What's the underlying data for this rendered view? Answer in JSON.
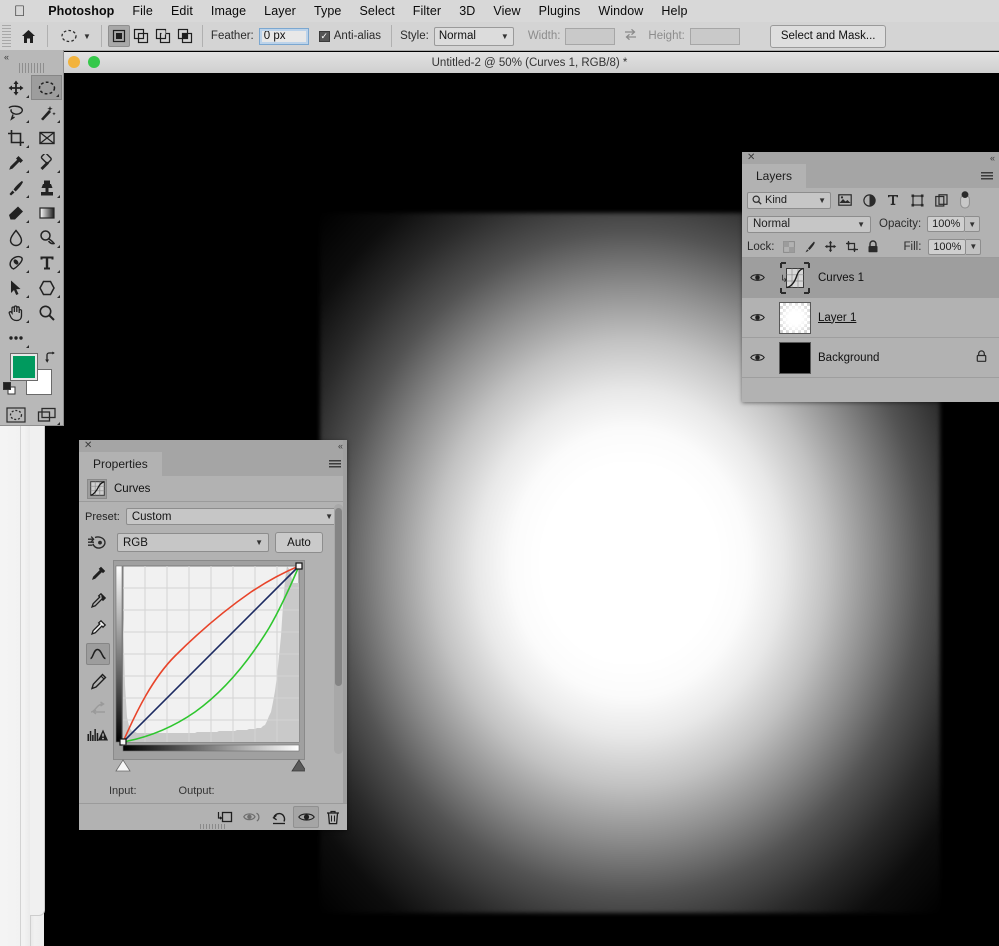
{
  "menubar": {
    "apple_icon": "apple-logo",
    "items": [
      "Photoshop",
      "File",
      "Edit",
      "Image",
      "Layer",
      "Type",
      "Select",
      "Filter",
      "3D",
      "View",
      "Plugins",
      "Window",
      "Help"
    ]
  },
  "options_bar": {
    "home_icon": "home-icon",
    "tool_preview_icon": "elliptical-marquee-icon",
    "selection_modes": [
      "new-selection",
      "add-to-selection",
      "subtract-from-selection",
      "intersect-with-selection"
    ],
    "active_selection_mode": 0,
    "feather_label": "Feather:",
    "feather_value": "0 px",
    "antialias_label": "Anti-alias",
    "antialias_checked": true,
    "style_label": "Style:",
    "style_value": "Normal",
    "width_label": "Width:",
    "width_value": "",
    "swap_icon": "swap-dimensions-icon",
    "height_label": "Height:",
    "height_value": "",
    "select_and_mask_label": "Select and Mask..."
  },
  "toolbar": {
    "collapse_icon": "collapse-double-chevron-icon",
    "tools": [
      {
        "name": "move-tool",
        "has_flyout": true,
        "active": false
      },
      {
        "name": "elliptical-marquee-tool",
        "has_flyout": true,
        "active": true
      },
      {
        "name": "lasso-tool",
        "has_flyout": true,
        "active": false
      },
      {
        "name": "magic-wand-tool",
        "has_flyout": true,
        "active": false
      },
      {
        "name": "crop-tool",
        "has_flyout": true,
        "active": false
      },
      {
        "name": "frame-tool",
        "has_flyout": false,
        "active": false
      },
      {
        "name": "eyedropper-tool",
        "has_flyout": true,
        "active": false
      },
      {
        "name": "spot-healing-brush-tool",
        "has_flyout": true,
        "active": false
      },
      {
        "name": "brush-tool",
        "has_flyout": true,
        "active": false
      },
      {
        "name": "clone-stamp-tool",
        "has_flyout": true,
        "active": false
      },
      {
        "name": "eraser-tool",
        "has_flyout": true,
        "active": false
      },
      {
        "name": "gradient-tool",
        "has_flyout": true,
        "active": false
      },
      {
        "name": "blur-tool",
        "has_flyout": true,
        "active": false
      },
      {
        "name": "dodge-tool",
        "has_flyout": true,
        "active": false
      },
      {
        "name": "pen-tool",
        "has_flyout": true,
        "active": false
      },
      {
        "name": "type-tool",
        "has_flyout": true,
        "active": false
      },
      {
        "name": "path-selection-tool",
        "has_flyout": true,
        "active": false
      },
      {
        "name": "shape-tool",
        "has_flyout": true,
        "active": false
      },
      {
        "name": "hand-tool",
        "has_flyout": true,
        "active": false
      },
      {
        "name": "zoom-tool",
        "has_flyout": false,
        "active": false
      },
      {
        "name": "edit-toolbar-tool",
        "has_flyout": true,
        "active": false
      }
    ],
    "foreground_color": "#009A5E",
    "background_color": "#FFFFFF",
    "swap_colors_icon": "swap-colors-icon",
    "default_colors_icon": "default-colors-icon",
    "quick_mask_icon": "quick-mask-icon",
    "screen_mode_icon": "screen-mode-icon"
  },
  "document": {
    "title": "Untitled-2 @ 50% (Curves 1, RGB/8) *",
    "traffic_lights": [
      "#f2b33d",
      "#35c84a"
    ],
    "zoom": "50%",
    "color_mode": "RGB/8",
    "active_layer": "Curves 1",
    "modified": true
  },
  "layers_panel": {
    "close_icon": "close-icon",
    "collapse_icon": "collapse-double-chevron-icon",
    "tab_label": "Layers",
    "menu_icon": "panel-menu-icon",
    "filter": {
      "search_icon": "search-icon",
      "kind_label": "Kind",
      "chevron_icon": "chevron-down-icon",
      "type_filters": [
        "pixel-layer-filter-icon",
        "adjustment-layer-filter-icon",
        "type-layer-filter-icon",
        "shape-layer-filter-icon",
        "smart-object-filter-icon"
      ],
      "toggle_icon": "filter-toggle-switch"
    },
    "blend_mode": "Normal",
    "opacity_label": "Opacity:",
    "opacity_value": "100%",
    "lock_label": "Lock:",
    "lock_icons": [
      "lock-transparent-pixels-icon",
      "lock-image-pixels-icon",
      "lock-position-icon",
      "lock-artboard-nesting-icon",
      "lock-all-icon"
    ],
    "fill_label": "Fill:",
    "fill_value": "100%",
    "layers": [
      {
        "name": "Curves 1",
        "visible": true,
        "selected": true,
        "thumb": "curves-adjustment-thumbnail",
        "clipped": true,
        "locked": false,
        "underlined": false
      },
      {
        "name": "Layer 1",
        "visible": true,
        "selected": false,
        "thumb": "transparent-glow-thumbnail",
        "clipped": false,
        "locked": false,
        "underlined": true
      },
      {
        "name": "Background",
        "visible": true,
        "selected": false,
        "thumb": "black-thumbnail",
        "clipped": false,
        "locked": true,
        "underlined": false
      }
    ]
  },
  "properties_panel": {
    "close_icon": "close-icon",
    "collapse_icon": "collapse-double-chevron-icon",
    "tab_label": "Properties",
    "menu_icon": "panel-menu-icon",
    "adjustment_icon": "curves-adjustment-icon",
    "adjustment_title": "Curves",
    "preset_label": "Preset:",
    "preset_value": "Custom",
    "target_adjustment_icon": "on-image-adjustment-icon",
    "channel_value": "RGB",
    "auto_label": "Auto",
    "curve_tools": [
      {
        "name": "set-black-point-eyedropper",
        "active": false
      },
      {
        "name": "set-gray-point-eyedropper",
        "active": false
      },
      {
        "name": "set-white-point-eyedropper",
        "active": false
      },
      {
        "name": "edit-points-curve-tool",
        "active": true
      },
      {
        "name": "draw-curve-pencil-tool",
        "active": false
      },
      {
        "name": "smooth-curve-tool",
        "active": false
      },
      {
        "name": "show-clipping-histogram-tool",
        "active": false
      }
    ],
    "input_label": "Input:",
    "input_value": "",
    "output_label": "Output:",
    "output_value": "",
    "bottom_buttons": [
      {
        "name": "clip-to-layer-button",
        "active": false
      },
      {
        "name": "view-previous-state-button",
        "active": false
      },
      {
        "name": "reset-adjustment-button",
        "active": false
      },
      {
        "name": "toggle-layer-visibility-button",
        "active": true
      },
      {
        "name": "delete-adjustment-layer-button",
        "active": false
      }
    ]
  },
  "chart_data": {
    "type": "line",
    "title": "Curves 1 — RGB tone curve",
    "xlabel": "Input",
    "ylabel": "Output",
    "xlim": [
      0,
      255
    ],
    "ylim": [
      0,
      255
    ],
    "grid": true,
    "grid_divisions": 8,
    "legend": "none",
    "control_points": [
      {
        "input": 0,
        "output": 0
      },
      {
        "input": 255,
        "output": 255
      }
    ],
    "series": [
      {
        "name": "Red",
        "color": "#e8442a",
        "x": [
          0,
          32,
          64,
          96,
          128,
          160,
          192,
          224,
          255
        ],
        "y": [
          0,
          68,
          118,
          155,
          182,
          203,
          221,
          239,
          255
        ]
      },
      {
        "name": "RGB composite",
        "color": "#1c2a62",
        "x": [
          0,
          32,
          64,
          96,
          128,
          160,
          192,
          224,
          255
        ],
        "y": [
          0,
          32,
          64,
          96,
          128,
          160,
          192,
          224,
          255
        ]
      },
      {
        "name": "Green",
        "color": "#2ec62e",
        "x": [
          0,
          32,
          64,
          96,
          128,
          160,
          192,
          224,
          255
        ],
        "y": [
          0,
          10,
          24,
          42,
          66,
          98,
          140,
          190,
          255
        ]
      }
    ],
    "histogram": {
      "description": "Input histogram shown behind the grid — heavy spikes at both shadow and highlight extremes with a low flat midtone floor",
      "bins": [
        0.7,
        0.32,
        0.14,
        0.09,
        0.07,
        0.06,
        0.06,
        0.05,
        0.05,
        0.05,
        0.05,
        0.05,
        0.05,
        0.05,
        0.05,
        0.05,
        0.05,
        0.05,
        0.05,
        0.05,
        0.05,
        0.05,
        0.05,
        0.05,
        0.05,
        0.05,
        0.05,
        0.05,
        0.05,
        0.05,
        0.05,
        0.05,
        0.05,
        0.05,
        0.05,
        0.05,
        0.05,
        0.06,
        0.06,
        0.06,
        0.06,
        0.06,
        0.06,
        0.06,
        0.06,
        0.06,
        0.06,
        0.06,
        0.07,
        0.07,
        0.07,
        0.07,
        0.07,
        0.07,
        0.07,
        0.07,
        0.07,
        0.08,
        0.08,
        0.08,
        0.08,
        0.08,
        0.08,
        0.09,
        0.09,
        0.09,
        0.09,
        0.1,
        0.1,
        0.1,
        0.11,
        0.11,
        0.12,
        0.13,
        0.14,
        0.17,
        0.22,
        0.3,
        0.42,
        0.6,
        0.78,
        0.92,
        1.0,
        0.98,
        0.94,
        0.9
      ]
    },
    "black_slider": 0,
    "white_slider": 255
  }
}
